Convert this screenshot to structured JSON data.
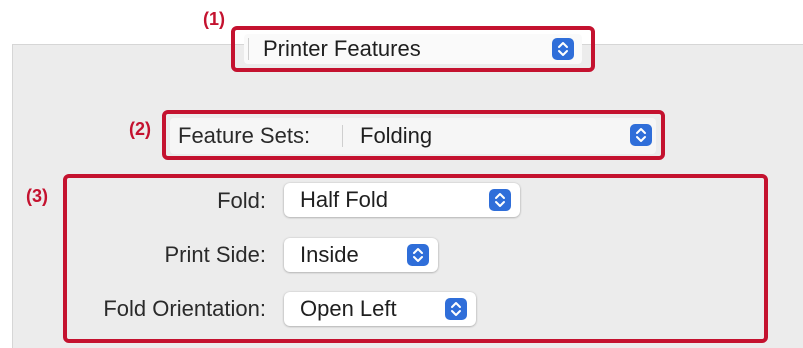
{
  "callouts": {
    "c1": "(1)",
    "c2": "(2)",
    "c3": "(3)"
  },
  "top_menu": {
    "value": "Printer Features"
  },
  "feature_sets": {
    "label": "Feature Sets:",
    "value": "Folding"
  },
  "options": {
    "fold": {
      "label": "Fold:",
      "value": "Half Fold"
    },
    "print_side": {
      "label": "Print Side:",
      "value": "Inside"
    },
    "fold_orientation": {
      "label": "Fold Orientation:",
      "value": "Open Left"
    }
  },
  "colors": {
    "callout": "#c4122f",
    "stepper": "#2f6ed9",
    "panel": "#ececec"
  },
  "icons": {
    "stepper": "up-down-chevron-icon"
  }
}
